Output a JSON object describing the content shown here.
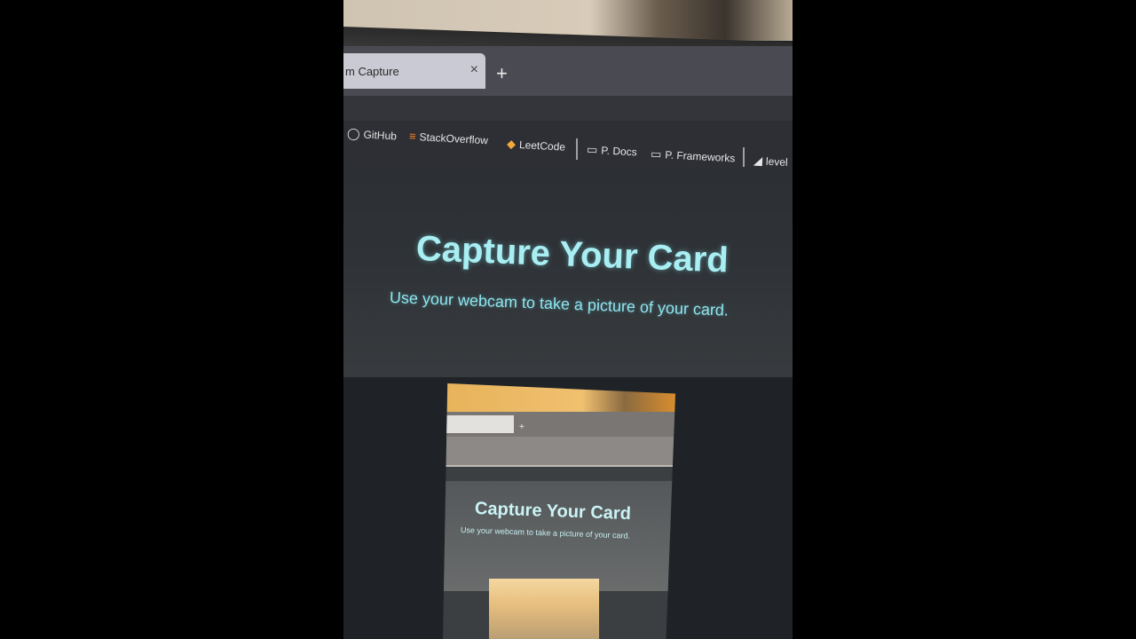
{
  "browser": {
    "tab_title": "m Capture",
    "tab_close": "×",
    "new_tab": "+"
  },
  "bookmarks": [
    {
      "icon": "github-icon",
      "label": "GitHub",
      "glyph": "◯"
    },
    {
      "icon": "stackoverflow-icon",
      "label": "StackOverflow",
      "glyph": "≡"
    },
    {
      "icon": "leetcode-icon",
      "label": "LeetCode",
      "glyph": "◆"
    },
    {
      "icon": "folder-icon",
      "label": "P. Docs",
      "glyph": "▭"
    },
    {
      "icon": "folder-icon",
      "label": "P. Frameworks",
      "glyph": "▭"
    },
    {
      "icon": "chart-icon",
      "label": "level",
      "glyph": "◢"
    }
  ],
  "page": {
    "title": "Capture Your Card",
    "subtitle": "Use your webcam to take a picture of your card."
  },
  "preview": {
    "title": "Capture Your Card",
    "subtitle": "Use your webcam to take a picture of your card.",
    "new_tab": "+"
  },
  "colors": {
    "accent": "#a8eef2",
    "background": "#1f2327"
  }
}
